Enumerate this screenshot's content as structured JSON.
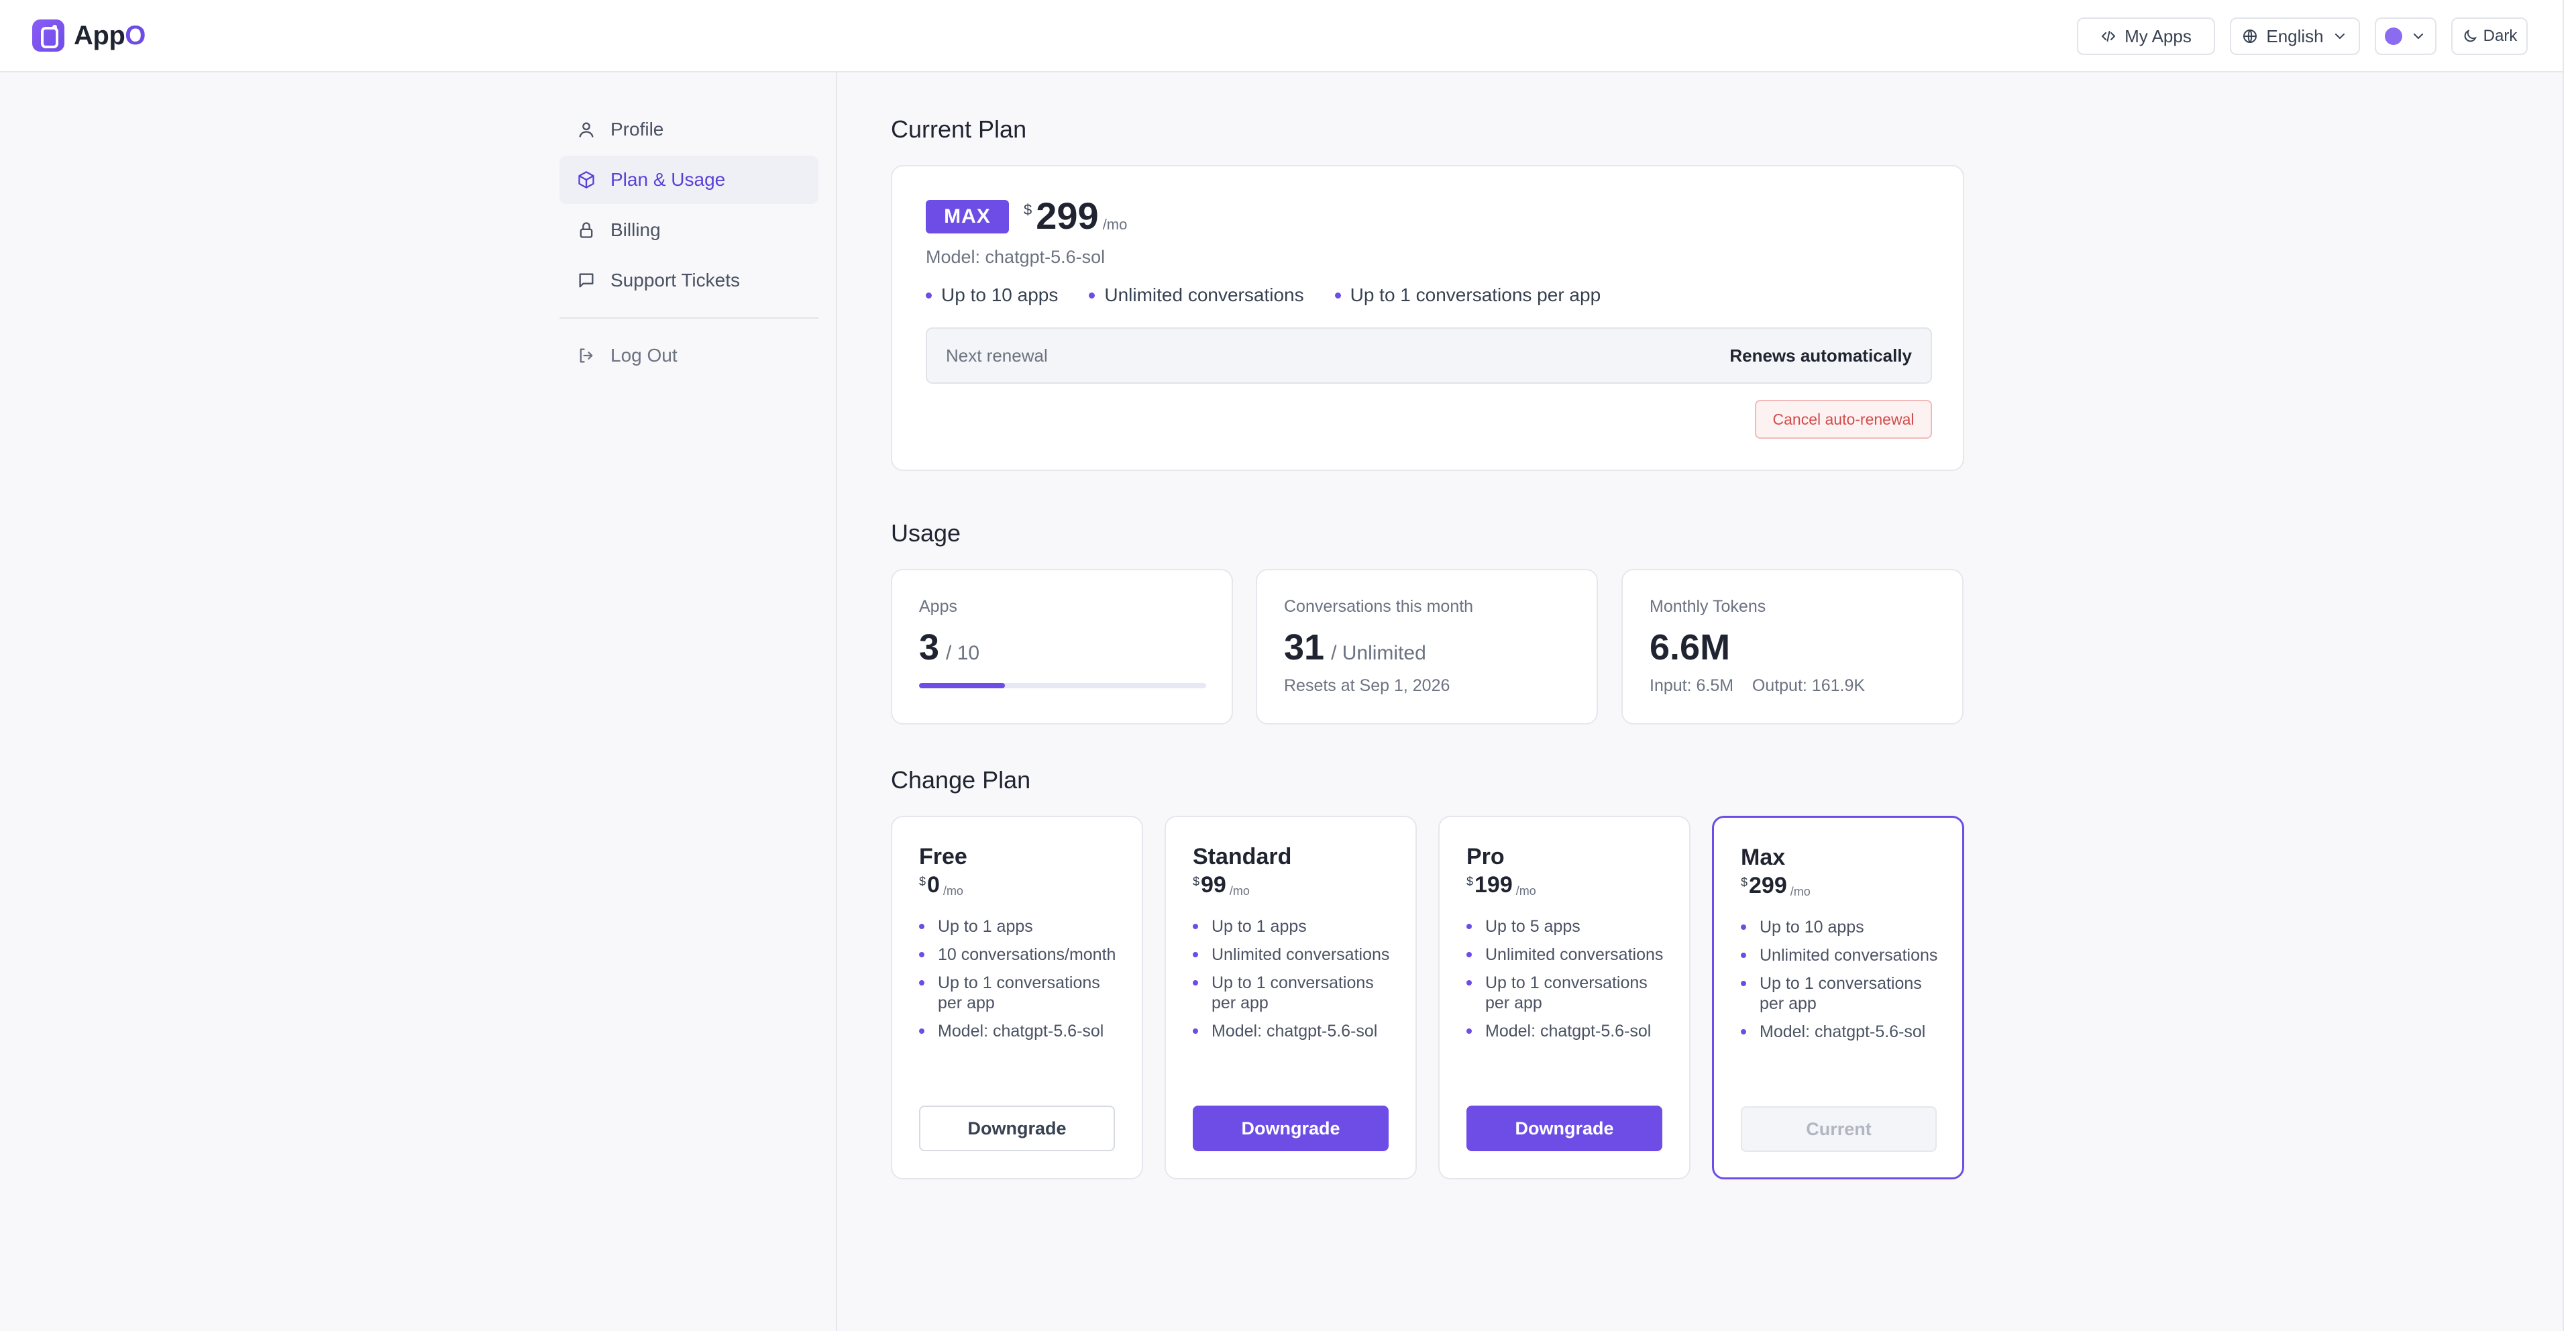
{
  "app": {
    "name_main": "App",
    "name_accent": "O",
    "brand_color": "#6d4de6"
  },
  "header": {
    "my_apps": "My Apps",
    "language": "English",
    "theme_toggle": "Dark"
  },
  "sidebar": {
    "items": [
      {
        "label": "Profile",
        "icon": "user-icon",
        "active": false
      },
      {
        "label": "Plan & Usage",
        "icon": "box-icon",
        "active": true
      },
      {
        "label": "Billing",
        "icon": "lock-icon",
        "active": false
      },
      {
        "label": "Support Tickets",
        "icon": "message-icon",
        "active": false
      }
    ],
    "logout": "Log Out"
  },
  "current_plan": {
    "section_title": "Current Plan",
    "badge": "MAX",
    "currency": "$",
    "price": "299",
    "period": "/mo",
    "model": "Model: chatgpt-5.6-sol",
    "features": [
      "Up to 10 apps",
      "Unlimited conversations",
      "Up to 1 conversations per app"
    ],
    "renewal_label": "Next renewal",
    "renewal_value": "Renews automatically",
    "cancel_label": "Cancel auto-renewal"
  },
  "usage": {
    "section_title": "Usage",
    "apps": {
      "label": "Apps",
      "value": "3",
      "limit": "/ 10",
      "progress_fraction": 0.3
    },
    "conversations": {
      "label": "Conversations this month",
      "value": "31",
      "limit": "/ Unlimited",
      "sub": "Resets at Sep 1, 2026"
    },
    "tokens": {
      "label": "Monthly Tokens",
      "value": "6.6M",
      "sub": "Input: 6.5M    Output: 161.9K"
    }
  },
  "change_plan": {
    "section_title": "Change Plan",
    "plans": [
      {
        "name": "Free",
        "currency": "$",
        "price": "0",
        "period": "/mo",
        "features": [
          "Up to 1 apps",
          "10 conversations/month",
          "Up to 1 conversations per app",
          "Model: chatgpt-5.6-sol"
        ],
        "button": "Downgrade",
        "style": "outline"
      },
      {
        "name": "Standard",
        "currency": "$",
        "price": "99",
        "period": "/mo",
        "features": [
          "Up to 1 apps",
          "Unlimited conversations",
          "Up to 1 conversations per app",
          "Model: chatgpt-5.6-sol"
        ],
        "button": "Downgrade",
        "style": "solid"
      },
      {
        "name": "Pro",
        "currency": "$",
        "price": "199",
        "period": "/mo",
        "features": [
          "Up to 5 apps",
          "Unlimited conversations",
          "Up to 1 conversations per app",
          "Model: chatgpt-5.6-sol"
        ],
        "button": "Downgrade",
        "style": "solid"
      },
      {
        "name": "Max",
        "currency": "$",
        "price": "299",
        "period": "/mo",
        "features": [
          "Up to 10 apps",
          "Unlimited conversations",
          "Up to 1 conversations per app",
          "Model: chatgpt-5.6-sol"
        ],
        "button": "Current",
        "style": "disabled"
      }
    ]
  }
}
